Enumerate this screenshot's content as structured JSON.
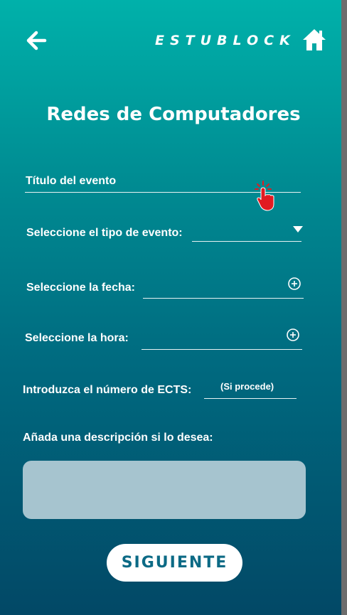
{
  "header": {
    "brand": "ESTUBLOCK",
    "back_icon": "arrow-left-icon",
    "home_icon": "home-icon"
  },
  "page": {
    "title": "Redes de Computadores"
  },
  "form": {
    "event_title": {
      "placeholder": "Título del evento",
      "value": ""
    },
    "event_type": {
      "label": "Seleccione el tipo de evento:",
      "value": "",
      "icon": "caret-down-icon"
    },
    "date": {
      "label": "Seleccione la fecha:",
      "value": "",
      "icon": "plus-circle-icon"
    },
    "time": {
      "label": "Seleccione la hora:",
      "value": "",
      "icon": "plus-circle-icon"
    },
    "ects": {
      "label": "Introduzca el número de ECTS:",
      "hint": "(Si procede)",
      "value": ""
    },
    "description": {
      "label": "Añada una descripción si lo desea:",
      "value": ""
    }
  },
  "actions": {
    "next_label": "SIGUIENTE"
  },
  "colors": {
    "gradient_top": "#00b1aa",
    "gradient_bottom": "#024866",
    "button_text": "#0c6a85",
    "textarea_bg": "#a6c4cf",
    "cursor_accent": "#e11b22"
  }
}
